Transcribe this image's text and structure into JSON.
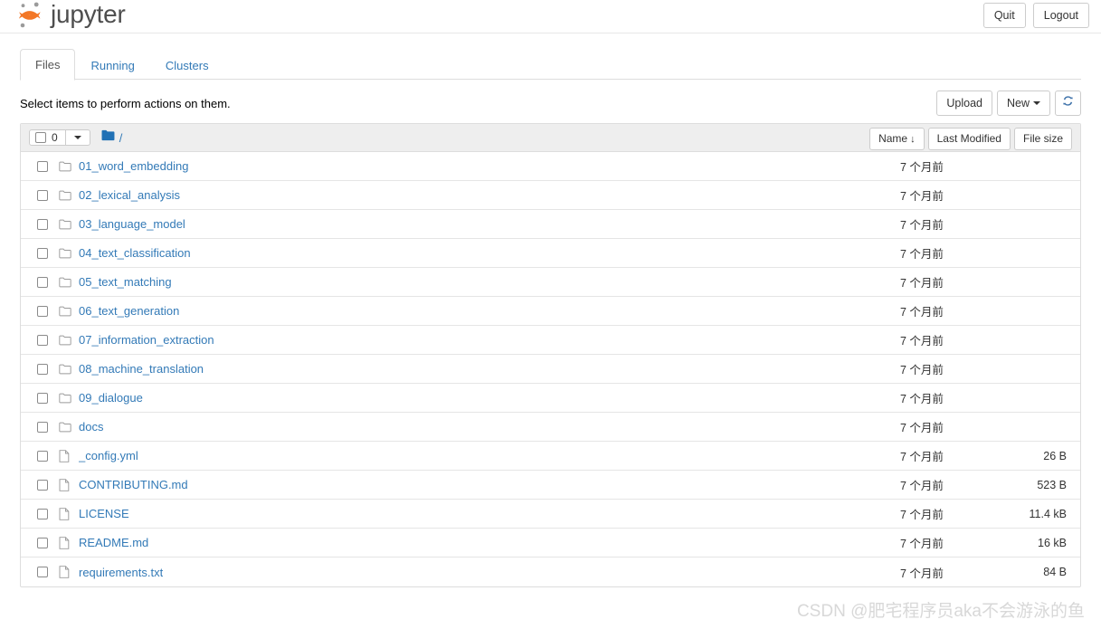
{
  "header": {
    "brand": "jupyter",
    "logo_icon": "jupyter-logo-icon",
    "quit_label": "Quit",
    "logout_label": "Logout"
  },
  "tabs": [
    {
      "label": "Files",
      "active": true
    },
    {
      "label": "Running",
      "active": false
    },
    {
      "label": "Clusters",
      "active": false
    }
  ],
  "actions": {
    "select_hint": "Select items to perform actions on them.",
    "upload_label": "Upload",
    "new_label": "New",
    "refresh_icon": "refresh-icon"
  },
  "toolbar": {
    "selected_count": "0",
    "select_all_checkbox": "select-all-checkbox",
    "select_dropdown_icon": "chevron-down-icon",
    "breadcrumb_folder_icon": "folder-filled-icon",
    "breadcrumb_root": "/",
    "sort_name": "Name",
    "sort_name_arrow": "↓",
    "sort_last_modified": "Last Modified",
    "sort_file_size": "File size"
  },
  "colors": {
    "link": "#337ab7",
    "brand_orange": "#f37726",
    "breadcrumb_folder": "#2171b5",
    "panel_header_bg": "#eeeeee",
    "border": "#dddddd",
    "watermark": "#d8d8d8"
  },
  "files": [
    {
      "name": "01_word_embedding",
      "type": "folder",
      "modified": "7 个月前",
      "size": ""
    },
    {
      "name": "02_lexical_analysis",
      "type": "folder",
      "modified": "7 个月前",
      "size": ""
    },
    {
      "name": "03_language_model",
      "type": "folder",
      "modified": "7 个月前",
      "size": ""
    },
    {
      "name": "04_text_classification",
      "type": "folder",
      "modified": "7 个月前",
      "size": ""
    },
    {
      "name": "05_text_matching",
      "type": "folder",
      "modified": "7 个月前",
      "size": ""
    },
    {
      "name": "06_text_generation",
      "type": "folder",
      "modified": "7 个月前",
      "size": ""
    },
    {
      "name": "07_information_extraction",
      "type": "folder",
      "modified": "7 个月前",
      "size": ""
    },
    {
      "name": "08_machine_translation",
      "type": "folder",
      "modified": "7 个月前",
      "size": ""
    },
    {
      "name": "09_dialogue",
      "type": "folder",
      "modified": "7 个月前",
      "size": ""
    },
    {
      "name": "docs",
      "type": "folder",
      "modified": "7 个月前",
      "size": ""
    },
    {
      "name": "_config.yml",
      "type": "file",
      "modified": "7 个月前",
      "size": "26 B"
    },
    {
      "name": "CONTRIBUTING.md",
      "type": "file",
      "modified": "7 个月前",
      "size": "523 B"
    },
    {
      "name": "LICENSE",
      "type": "file",
      "modified": "7 个月前",
      "size": "11.4 kB"
    },
    {
      "name": "README.md",
      "type": "file",
      "modified": "7 个月前",
      "size": "16 kB"
    },
    {
      "name": "requirements.txt",
      "type": "file",
      "modified": "7 个月前",
      "size": "84 B"
    }
  ],
  "watermark": "CSDN @肥宅程序员aka不会游泳的鱼"
}
